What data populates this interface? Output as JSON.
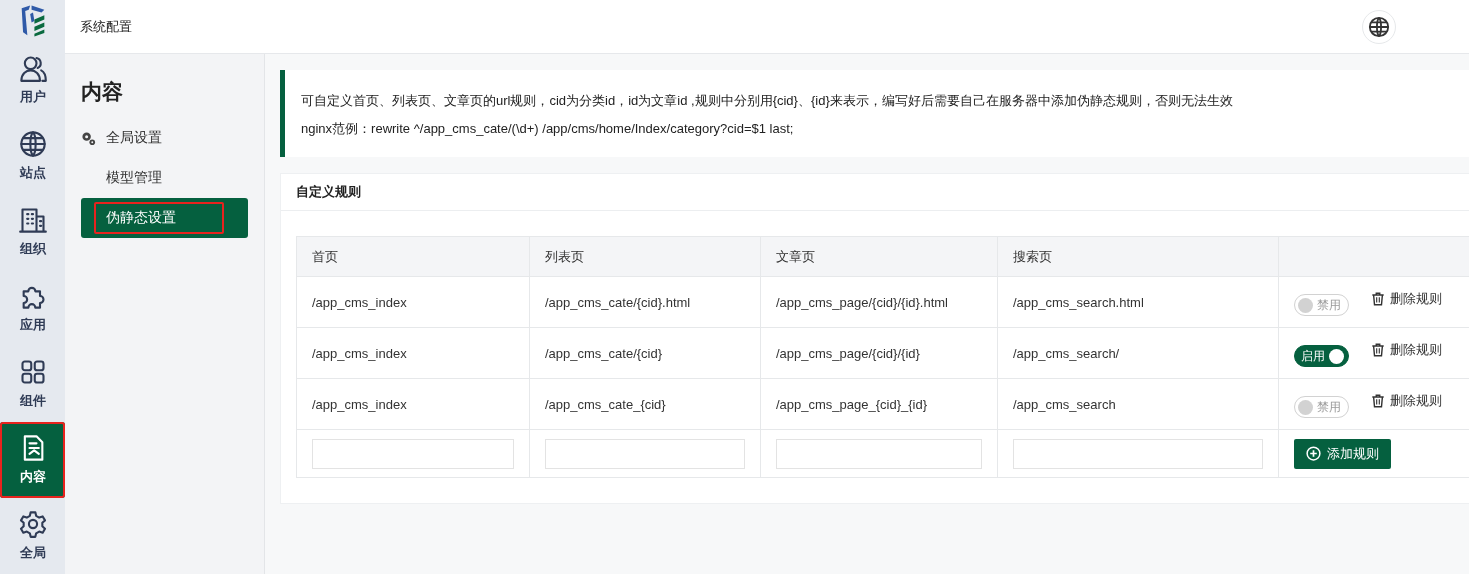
{
  "header": {
    "title": "系统配置"
  },
  "rail": {
    "items": [
      {
        "label": "用户",
        "selected": false,
        "marked": false
      },
      {
        "label": "站点",
        "selected": false,
        "marked": false
      },
      {
        "label": "组织",
        "selected": false,
        "marked": false
      },
      {
        "label": "应用",
        "selected": false,
        "marked": false
      },
      {
        "label": "组件",
        "selected": false,
        "marked": false
      },
      {
        "label": "内容",
        "selected": true,
        "marked": true
      },
      {
        "label": "全局",
        "selected": false,
        "marked": false
      }
    ]
  },
  "sidebar": {
    "title": "内容",
    "items": [
      {
        "label": "全局设置",
        "kind": "group",
        "selected": false,
        "marked": false
      },
      {
        "label": "模型管理",
        "kind": "link",
        "selected": false,
        "marked": false
      },
      {
        "label": "伪静态设置",
        "kind": "link",
        "selected": true,
        "marked": true
      }
    ]
  },
  "notice": {
    "lines": [
      "可自定义首页、列表页、文章页的url规则，cid为分类id，id为文章id ,规则中分别用{cid}、{id}来表示，编写好后需要自己在服务器中添加伪静态规则，否则无法生效",
      "nginx范例：rewrite ^/app_cms_cate/(\\d+) /app/cms/home/Index/category?cid=$1 last;"
    ]
  },
  "card": {
    "title": "自定义规则",
    "table": {
      "columns": [
        "首页",
        "列表页",
        "文章页",
        "搜索页"
      ],
      "rows": [
        {
          "cells": [
            "/app_cms_index",
            "/app_cms_cate/{cid}.html",
            "/app_cms_page/{cid}/{id}.html",
            "/app_cms_search.html"
          ],
          "toggle": {
            "on": false,
            "label": "禁用"
          },
          "delete": "删除规则"
        },
        {
          "cells": [
            "/app_cms_index",
            "/app_cms_cate/{cid}",
            "/app_cms_page/{cid}/{id}",
            "/app_cms_search/"
          ],
          "toggle": {
            "on": true,
            "label": "启用"
          },
          "delete": "删除规则"
        },
        {
          "cells": [
            "/app_cms_index",
            "/app_cms_cate_{cid}",
            "/app_cms_page_{cid}_{id}",
            "/app_cms_search"
          ],
          "toggle": {
            "on": false,
            "label": "禁用"
          },
          "delete": "删除规则"
        }
      ],
      "add_button": "添加规则"
    }
  }
}
